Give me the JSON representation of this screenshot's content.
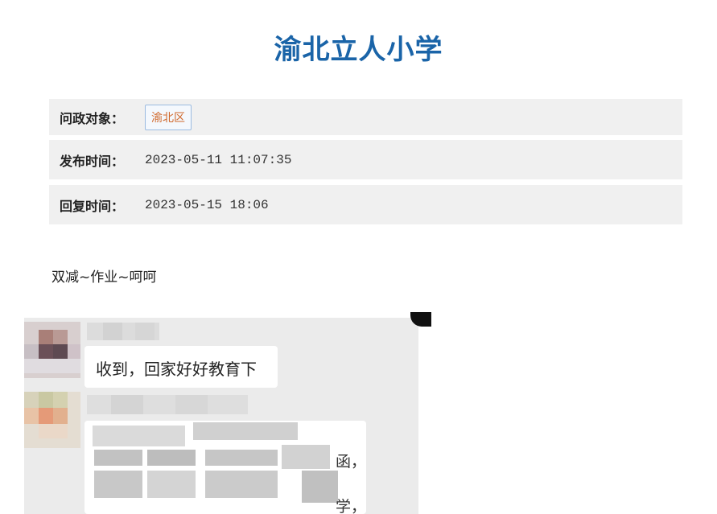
{
  "page": {
    "title": "渝北立人小学"
  },
  "info": {
    "target_label": "问政对象：",
    "target_value": "渝北区",
    "publish_label": "发布时间：",
    "publish_value": "2023-05-11 11:07:35",
    "reply_label": "回复时间：",
    "reply_value": "2023-05-15 18:06"
  },
  "content": {
    "text": "双减~作业~呵呵"
  },
  "chat_screenshot": {
    "message_1": "收到，回家好好教育下",
    "fragment_1": "函，",
    "fragment_2": "学，"
  }
}
